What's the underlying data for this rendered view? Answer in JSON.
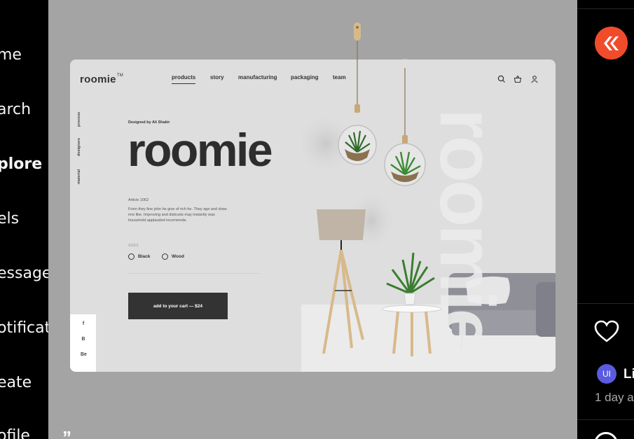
{
  "nav": {
    "items": [
      {
        "label": "me",
        "bold": false
      },
      {
        "label": "arch",
        "bold": false
      },
      {
        "label": "plore",
        "bold": true
      },
      {
        "label": "els",
        "bold": false
      },
      {
        "label": "essages",
        "bold": false
      },
      {
        "label": "otificatio",
        "bold": false
      },
      {
        "label": "eate",
        "bold": false
      },
      {
        "label": "ofile",
        "bold": false
      }
    ]
  },
  "post": {
    "corner_glyph": "”",
    "design": {
      "brand": "roomie",
      "trademark": "TM",
      "nav": [
        "products",
        "story",
        "manufacturing",
        "packaging",
        "team"
      ],
      "vertical_tabs": [
        "process",
        "designers",
        "material"
      ],
      "designed_by": "Designed by Ali Shakir",
      "hero_title": "roomie",
      "ghost_text": "roomie",
      "article": "Article 1062",
      "description": "From they fine john he give of rich he. They age and draw mrs like. Improving and distrusts may instantly was household applauded incommode.",
      "sizes_label": "SIZES",
      "options": [
        "Black",
        "Wood"
      ],
      "cart_button": "add to your cart — $24",
      "social": [
        "f",
        "B",
        "Be"
      ]
    }
  },
  "side": {
    "username": "Li",
    "avatar_initials": "UI",
    "time": "1 day a",
    "colors": {
      "accent": "#f04c2b",
      "avatar": "#5b5be0"
    }
  }
}
